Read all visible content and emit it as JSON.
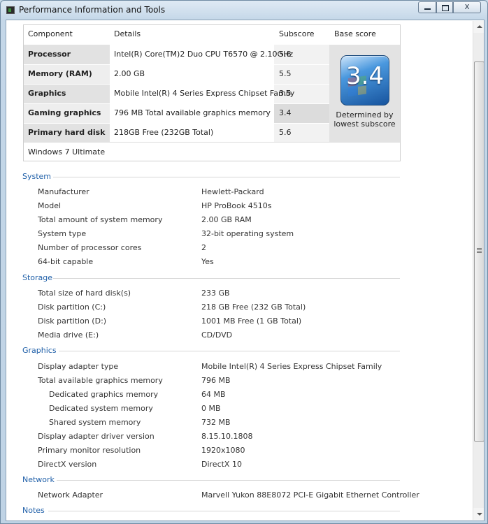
{
  "window": {
    "title": "Performance Information and Tools"
  },
  "controls": {
    "minimize": "",
    "maximize": "",
    "close": "X"
  },
  "score_table": {
    "headers": {
      "component": "Component",
      "details": "Details",
      "subscore": "Subscore",
      "base": "Base score"
    },
    "rows": [
      {
        "component": "Processor",
        "details": "Intel(R) Core(TM)2 Duo CPU T6570 @ 2.10GHz",
        "subscore": "5.6"
      },
      {
        "component": "Memory (RAM)",
        "details": "2.00 GB",
        "subscore": "5.5"
      },
      {
        "component": "Graphics",
        "details": "Mobile Intel(R) 4 Series Express Chipset Family",
        "subscore": "3.5"
      },
      {
        "component": "Gaming graphics",
        "details": "796 MB Total available graphics memory",
        "subscore": "3.4"
      },
      {
        "component": "Primary hard disk",
        "details": "218GB Free (232GB Total)",
        "subscore": "5.6"
      }
    ],
    "base_score": "3.4",
    "base_caption_line1": "Determined by",
    "base_caption_line2": "lowest subscore",
    "os": "Windows 7 Ultimate"
  },
  "sections": {
    "system": {
      "title": "System",
      "rows": [
        {
          "label": "Manufacturer",
          "value": "Hewlett-Packard"
        },
        {
          "label": "Model",
          "value": "HP ProBook 4510s"
        },
        {
          "label": "Total amount of system memory",
          "value": "2.00 GB RAM"
        },
        {
          "label": "System type",
          "value": "32-bit operating system"
        },
        {
          "label": "Number of processor cores",
          "value": "2"
        },
        {
          "label": "64-bit capable",
          "value": "Yes"
        }
      ]
    },
    "storage": {
      "title": "Storage",
      "rows": [
        {
          "label": "Total size of hard disk(s)",
          "value": "233 GB"
        },
        {
          "label": "Disk partition (C:)",
          "value": "218 GB Free (232 GB Total)"
        },
        {
          "label": "Disk partition (D:)",
          "value": "1001 MB Free (1 GB Total)"
        },
        {
          "label": "Media drive (E:)",
          "value": "CD/DVD"
        }
      ]
    },
    "graphics": {
      "title": "Graphics",
      "rows": [
        {
          "label": "Display adapter type",
          "value": "Mobile Intel(R) 4 Series Express Chipset Family"
        },
        {
          "label": "Total available graphics memory",
          "value": "796 MB"
        },
        {
          "label": "Dedicated graphics memory",
          "value": "64 MB"
        },
        {
          "label": "Dedicated system memory",
          "value": "0 MB"
        },
        {
          "label": "Shared system memory",
          "value": "732 MB"
        },
        {
          "label": "Display adapter driver version",
          "value": "8.15.10.1808"
        },
        {
          "label": "Primary monitor resolution",
          "value": "1920x1080"
        },
        {
          "label": "DirectX version",
          "value": "DirectX 10"
        }
      ]
    },
    "network": {
      "title": "Network",
      "rows": [
        {
          "label": "Network Adapter",
          "value": "Marvell Yukon 88E8072 PCI-E Gigabit Ethernet Controller"
        }
      ]
    },
    "notes": {
      "title": "Notes"
    }
  },
  "icons": {
    "window_icon": "performance-tools-icon",
    "badge": "windows-experience-index-badge-icon"
  }
}
